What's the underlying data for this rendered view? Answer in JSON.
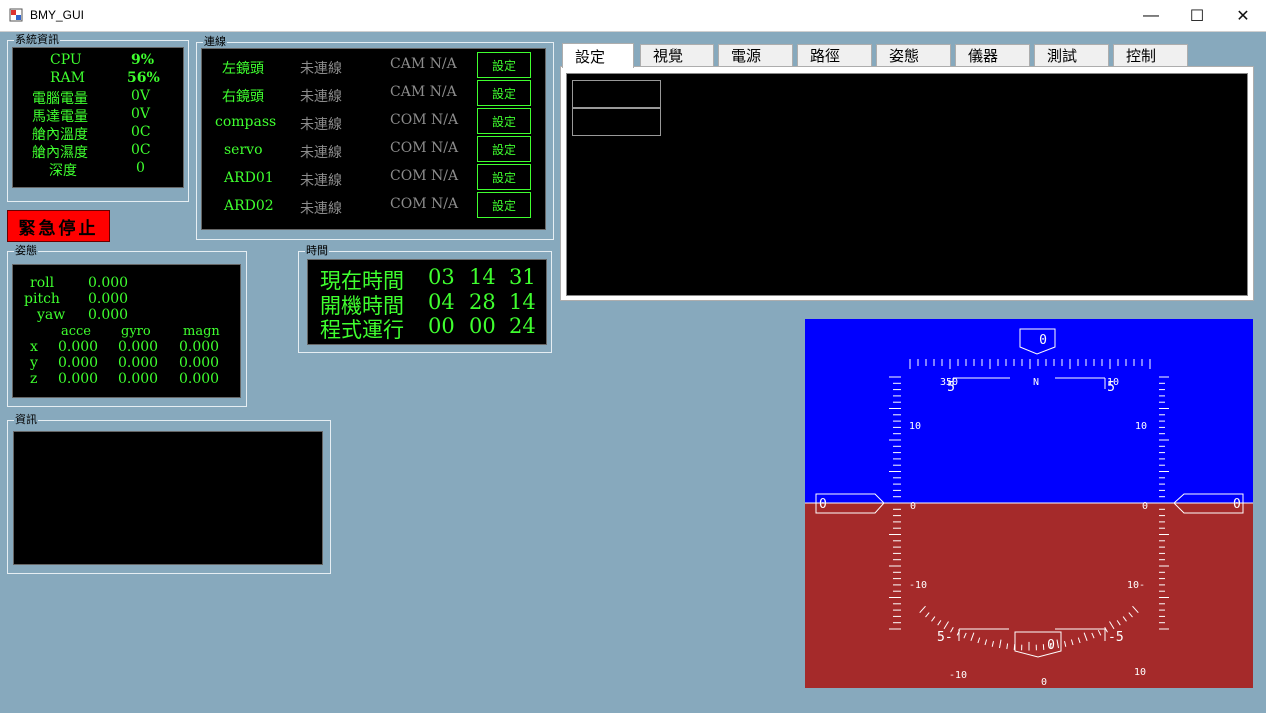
{
  "window": {
    "title": "BMY_GUI",
    "minimize": "—",
    "maximize": "☐",
    "close": "✕"
  },
  "sysinfo": {
    "title": "系統資訊",
    "rows": [
      {
        "label": "CPU",
        "value": "9%"
      },
      {
        "label": "RAM",
        "value": "56%"
      },
      {
        "label": "電腦電量",
        "value": "0V"
      },
      {
        "label": "馬達電量",
        "value": "0V"
      },
      {
        "label": "艙內溫度",
        "value": "0C"
      },
      {
        "label": "艙內濕度",
        "value": "0C"
      },
      {
        "label": "深度",
        "value": "0"
      }
    ]
  },
  "estop": {
    "label": "緊急停止"
  },
  "connection": {
    "title": "連線",
    "rows": [
      {
        "name": "左鏡頭",
        "status": "未連線",
        "port": "CAM N/A",
        "button": "設定"
      },
      {
        "name": "右鏡頭",
        "status": "未連線",
        "port": "CAM N/A",
        "button": "設定"
      },
      {
        "name": "compass",
        "status": "未連線",
        "port": "COM N/A",
        "button": "設定"
      },
      {
        "name": "servo",
        "status": "未連線",
        "port": "COM N/A",
        "button": "設定"
      },
      {
        "name": "ARD01",
        "status": "未連線",
        "port": "COM N/A",
        "button": "設定"
      },
      {
        "name": "ARD02",
        "status": "未連線",
        "port": "COM N/A",
        "button": "設定"
      }
    ]
  },
  "attitude": {
    "title": "姿態",
    "roll_label": "roll",
    "roll": "0.000",
    "pitch_label": "pitch",
    "pitch": "0.000",
    "yaw_label": "yaw",
    "yaw": "0.000",
    "headers": [
      "acce",
      "gyro",
      "magn"
    ],
    "axes": [
      {
        "axis": "x",
        "acce": "0.000",
        "gyro": "0.000",
        "magn": "0.000"
      },
      {
        "axis": "y",
        "acce": "0.000",
        "gyro": "0.000",
        "magn": "0.000"
      },
      {
        "axis": "z",
        "acce": "0.000",
        "gyro": "0.000",
        "magn": "0.000"
      }
    ]
  },
  "time": {
    "title": "時間",
    "rows": [
      {
        "label": "現在時間",
        "h": "03",
        "m": "14",
        "s": "31"
      },
      {
        "label": "開機時間",
        "h": "04",
        "m": "28",
        "s": "14"
      },
      {
        "label": "程式運行",
        "h": "00",
        "m": "00",
        "s": "24"
      }
    ]
  },
  "info": {
    "title": "資訊"
  },
  "tabs": [
    "設定",
    "視覺",
    "電源",
    "路徑",
    "姿態",
    "儀器",
    "測試",
    "控制"
  ],
  "hud": {
    "heading_box": "0",
    "compass_labels": {
      "left": "350",
      "center": "N",
      "right": "10"
    },
    "heading_side": {
      "left": "5",
      "right": "5"
    },
    "pitch_left_box": "0",
    "pitch_right_box": "0",
    "pitch_labels": {
      "up10": "10",
      "zero": "0",
      "down10": "-10",
      "down10r": "10-"
    },
    "bottom_left_mark": "5-",
    "bottom_right_mark": "-5",
    "roll_box": "0",
    "roll_labels": {
      "left": "-10",
      "center": "0",
      "right": "10"
    },
    "colors": {
      "sky": "#0000ff",
      "ground": "#a52a2a"
    }
  }
}
